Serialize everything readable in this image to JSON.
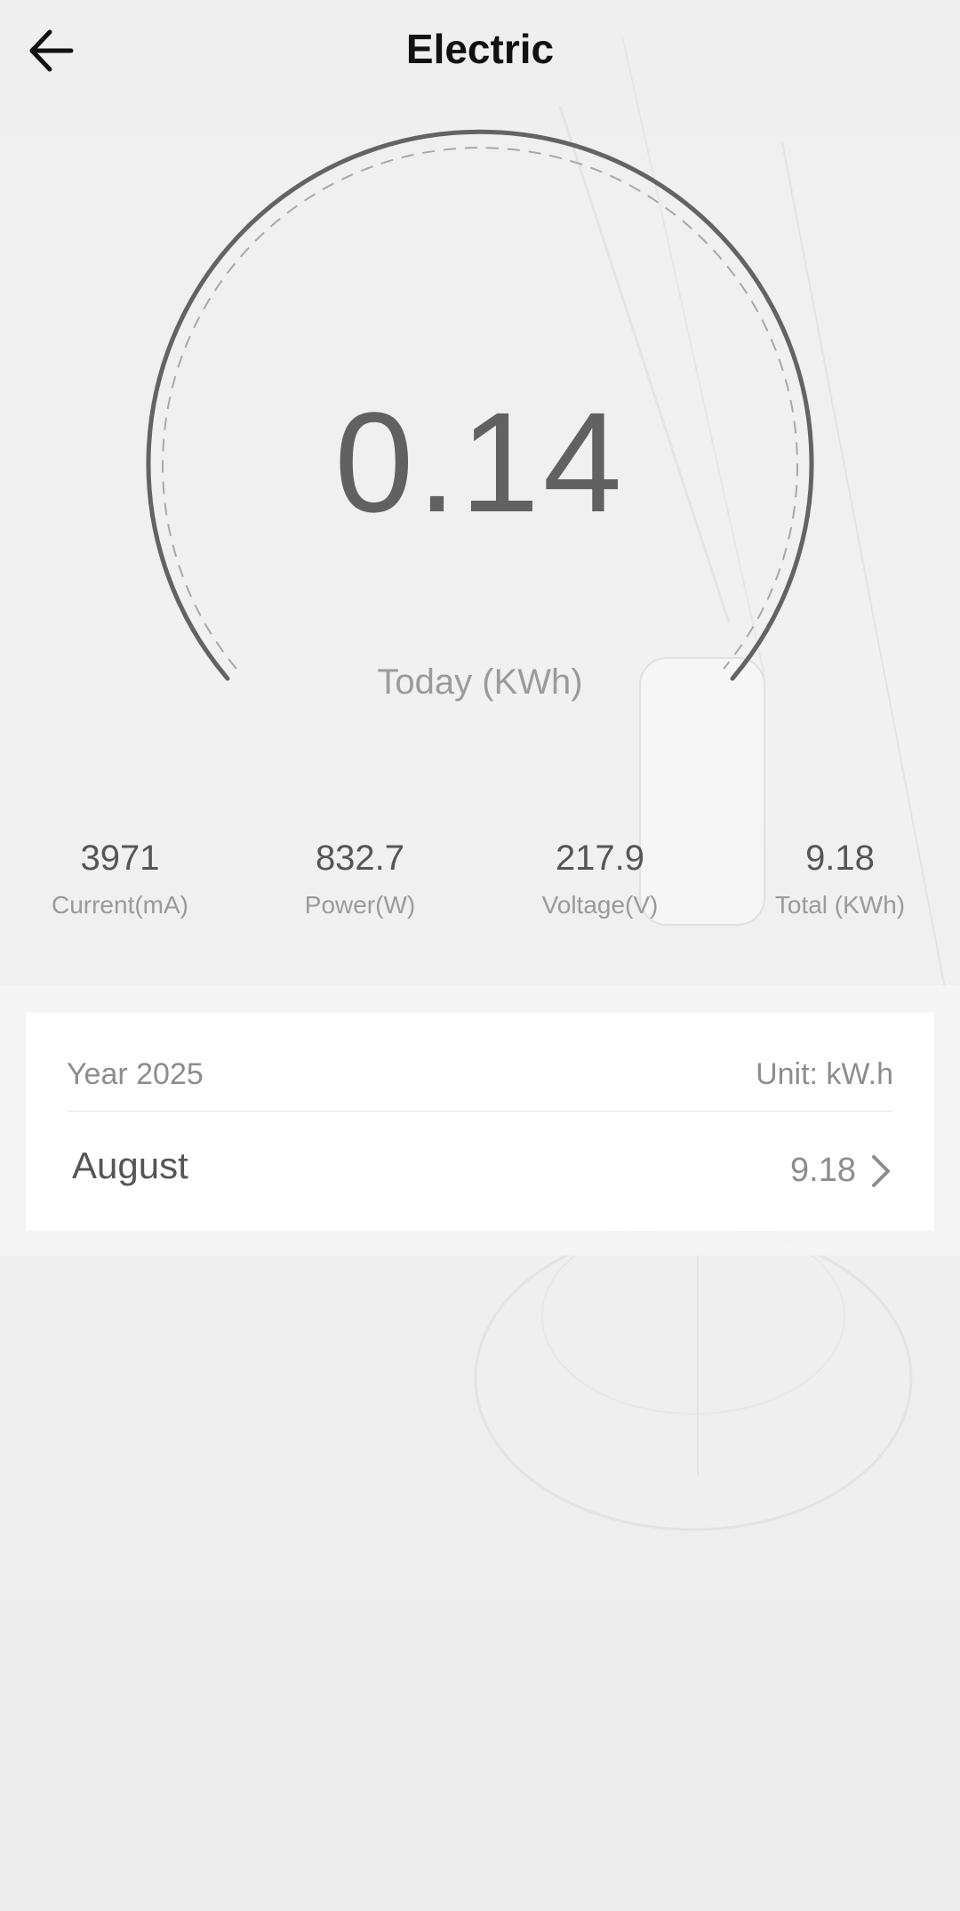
{
  "header": {
    "title": "Electric",
    "back_icon": "arrow-left-icon"
  },
  "gauge": {
    "value": "0.14",
    "label": "Today (KWh)"
  },
  "stats": [
    {
      "value": "3971",
      "label": "Current(mA)"
    },
    {
      "value": "832.7",
      "label": "Power(W)"
    },
    {
      "value": "217.9",
      "label": "Voltage(V)"
    },
    {
      "value": "9.18",
      "label": "Total (KWh)"
    }
  ],
  "summary": {
    "year": "Year 2025",
    "unit": "Unit: kW.h",
    "months": [
      {
        "name": "August",
        "value": "9.18"
      }
    ],
    "chevron_icon": "chevron-right-icon"
  },
  "colors": {
    "arc": "#636363",
    "text_primary": "#111111",
    "text_muted": "#9b9b9b"
  }
}
